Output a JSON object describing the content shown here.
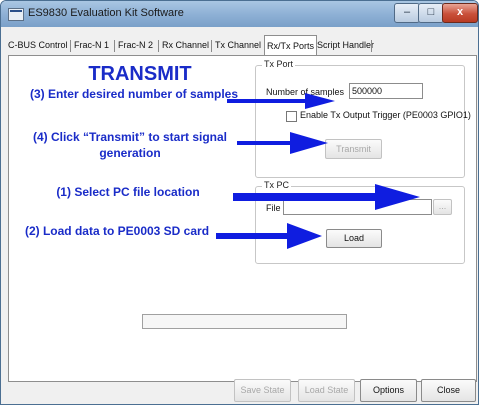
{
  "window": {
    "title": "ES9830 Evaluation Kit Software",
    "controls": {
      "minimize": "–",
      "maximize": "□",
      "close": "x"
    }
  },
  "tabs": [
    "C-BUS Control",
    "Frac-N 1",
    "Frac-N 2",
    "Rx Channel",
    "Tx Channel",
    "Rx/Tx Ports",
    "Script Handler"
  ],
  "tx_port": {
    "label": "Tx Port",
    "samples_label": "Number of samples",
    "samples_value": "500000",
    "trigger_label": "Enable Tx Output Trigger (PE0003 GPIO1)",
    "transmit_button": "Transmit"
  },
  "tx_pc": {
    "label": "Tx PC",
    "file_label": "File",
    "browse_button": "...",
    "load_button": "Load"
  },
  "annotations": {
    "heading": "TRANSMIT",
    "step3": "(3) Enter desired number of samples",
    "step4": "(4) Click “Transmit” to start signal generation",
    "step1": "(1) Select PC file location",
    "step2": "(2) Load data to PE0003 SD card"
  },
  "bottom": {
    "save_state": "Save State",
    "load_state": "Load State",
    "options": "Options",
    "close": "Close"
  },
  "colors": {
    "annotation": "#1a2cc8",
    "arrow": "#0f1de0",
    "titlebar": "#8fb1d6"
  }
}
